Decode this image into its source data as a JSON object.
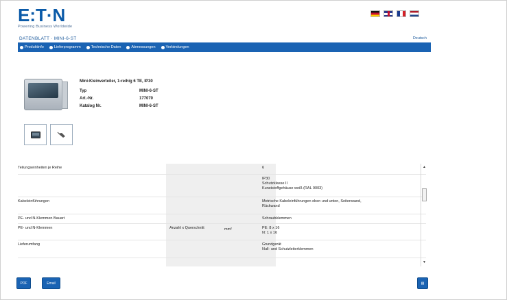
{
  "header": {
    "logo_text": "E:T·N",
    "logo_tagline": "Powering Business Worldwide",
    "sheet_title": "DATENBLATT · MINI-6-ST",
    "language_link": "Deutsch",
    "flags": [
      "de",
      "gb",
      "fr",
      "nl"
    ]
  },
  "nav": {
    "items": [
      {
        "label": "Produktinfo"
      },
      {
        "label": "Lieferprogramm"
      },
      {
        "label": "Technische Daten"
      },
      {
        "label": "Abmessungen"
      },
      {
        "label": "Verbindungen"
      }
    ]
  },
  "product": {
    "description": "Mini-Kleinverteiler, 1-reihig 6 TE, IP30",
    "type_label": "Typ",
    "type_value": "MINI-6-ST",
    "art_label": "Art.-Nr.",
    "art_value": "177070",
    "catalog_label": "Katalog Nr.",
    "catalog_value": "MINI-6-ST"
  },
  "table": {
    "rows": [
      {
        "left": "Teilungseinheiten je Reihe",
        "right": [
          "6"
        ]
      },
      {
        "left": "",
        "right": [
          "IP30",
          "Schutzklasse II",
          "Kunststoffgehäuse weiß (RAL 9003)"
        ]
      },
      {
        "left": "Kabeleinführungen",
        "right": [
          "Metrische Kabeleinführungen oben und unten, Seitenwand,",
          "Rückwand"
        ]
      },
      {
        "left": "PE- und N-Klemmen Bauart",
        "right": [
          "Schraubklemmen"
        ]
      },
      {
        "left": "PE- und N-Klemmen",
        "mid": "Anzahl x Querschnitt",
        "unit": "mm²",
        "right": [
          "PE: 8 x 16",
          "N: 1 x 16"
        ]
      },
      {
        "left": "Lieferumfang",
        "right": [
          "Grundgerät",
          "Null- und Schutzleiterklemmen"
        ]
      }
    ]
  },
  "footer": {
    "pdf_label": "PDF",
    "email_label": "Email",
    "print_label": "▤"
  }
}
